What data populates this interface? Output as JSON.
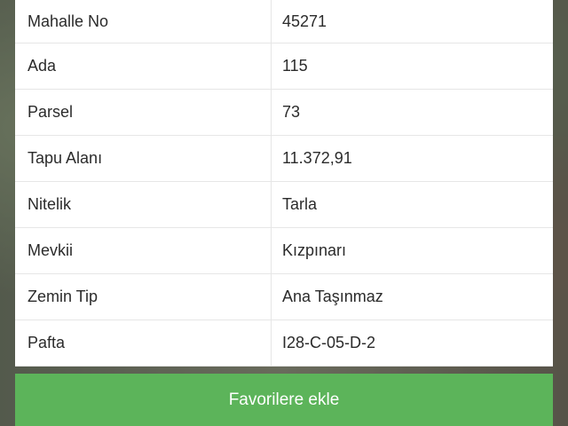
{
  "parcel_info": {
    "rows": [
      {
        "label": "Mahalle No",
        "value": "45271"
      },
      {
        "label": "Ada",
        "value": "115"
      },
      {
        "label": "Parsel",
        "value": "73"
      },
      {
        "label": "Tapu Alanı",
        "value": "11.372,91"
      },
      {
        "label": "Nitelik",
        "value": "Tarla"
      },
      {
        "label": "Mevkii",
        "value": "Kızpınarı"
      },
      {
        "label": "Zemin Tip",
        "value": "Ana Taşınmaz"
      },
      {
        "label": "Pafta",
        "value": "I28-C-05-D-2"
      }
    ]
  },
  "actions": {
    "favorite_label": "Favorilere ekle"
  },
  "colors": {
    "button_bg": "#5cb45a",
    "table_bg": "#ffffff",
    "text": "#2b2b2b"
  }
}
